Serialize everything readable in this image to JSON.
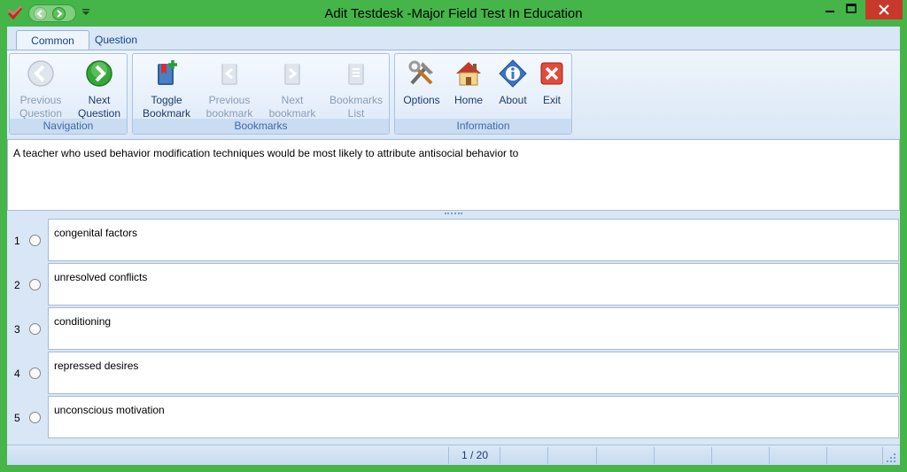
{
  "window": {
    "title": "Adit Testdesk -Major Field Test In Education"
  },
  "tabs": [
    {
      "label": "Common",
      "active": true
    },
    {
      "label": "Question",
      "active": false
    }
  ],
  "ribbon": {
    "groups": [
      {
        "label": "Navigation",
        "buttons": [
          {
            "line1": "Previous",
            "line2": "Question",
            "enabled": false
          },
          {
            "line1": "Next",
            "line2": "Question",
            "enabled": true
          }
        ]
      },
      {
        "label": "Bookmarks",
        "buttons": [
          {
            "line1": "Toggle",
            "line2": "Bookmark",
            "enabled": true
          },
          {
            "line1": "Previous",
            "line2": "bookmark",
            "enabled": false
          },
          {
            "line1": "Next",
            "line2": "bookmark",
            "enabled": false
          },
          {
            "line1": "Bookmarks",
            "line2": "List",
            "enabled": false
          }
        ]
      },
      {
        "label": "Information",
        "buttons": [
          {
            "line1": "Options",
            "line2": "",
            "enabled": true
          },
          {
            "line1": "Home",
            "line2": "",
            "enabled": true
          },
          {
            "line1": "About",
            "line2": "",
            "enabled": true
          },
          {
            "line1": "Exit",
            "line2": "",
            "enabled": true
          }
        ]
      }
    ]
  },
  "question": {
    "text": "A teacher who used behavior modification techniques would be most likely to attribute antisocial behavior to"
  },
  "options": [
    {
      "number": "1",
      "text": "congenital factors"
    },
    {
      "number": "2",
      "text": "unresolved conflicts"
    },
    {
      "number": "3",
      "text": "conditioning"
    },
    {
      "number": "4",
      "text": "repressed desires"
    },
    {
      "number": "5",
      "text": "unconscious motivation"
    }
  ],
  "status": {
    "page": "1 / 20"
  },
  "colors": {
    "frame": "#45b549",
    "ribbon": "#dbe8f7",
    "close": "#c8392b"
  }
}
